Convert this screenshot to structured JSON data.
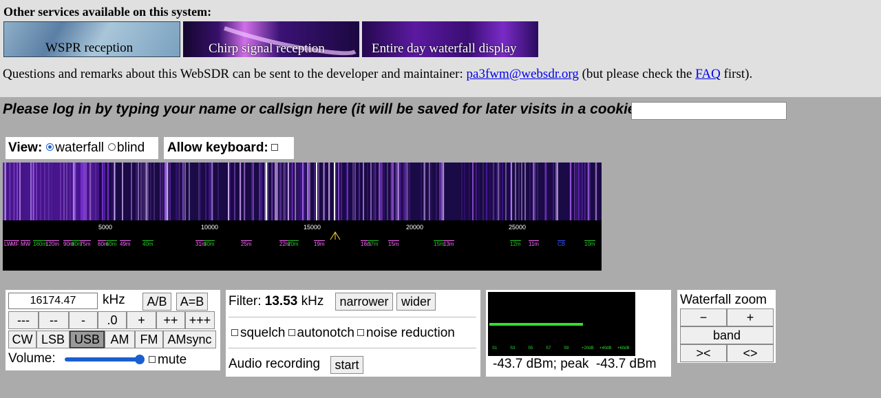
{
  "services": {
    "title": "Other services available on this system:",
    "items": [
      {
        "label": "WSPR reception"
      },
      {
        "label": "Chirp signal reception"
      },
      {
        "label": "Entire day waterfall display"
      }
    ]
  },
  "remarks": {
    "prefix": "Questions and remarks about this WebSDR can be sent to the developer and maintainer: ",
    "email": "pa3fwm@websdr.org",
    "middle": " (but please check the ",
    "faq": "FAQ",
    "suffix": " first)."
  },
  "login": {
    "prompt": "Please log in by typing your name or callsign here (it will be saved for later visits in a cookie):",
    "value": ""
  },
  "view": {
    "label": "View:",
    "options": [
      {
        "label": "waterfall",
        "selected": true
      },
      {
        "label": "blind",
        "selected": false
      }
    ]
  },
  "keyboard": {
    "label": "Allow keyboard:",
    "checked": false
  },
  "waterfall": {
    "ticks": [
      "5000",
      "10000",
      "15000",
      "20000",
      "25000"
    ],
    "bands": [
      {
        "label": "LW",
        "color": "#ff66ff"
      },
      {
        "label": "MF",
        "color": "#ff66ff"
      },
      {
        "label": "MW",
        "color": "#ff66ff"
      },
      {
        "label": "160m",
        "color": "#22cc22"
      },
      {
        "label": "120m",
        "color": "#ff66ff"
      },
      {
        "label": "90m",
        "color": "#ff66ff"
      },
      {
        "label": "80m",
        "color": "#22cc22"
      },
      {
        "label": "75m",
        "color": "#ff66ff"
      },
      {
        "label": "60m",
        "color": "#ff66ff"
      },
      {
        "label": "60m",
        "color": "#22cc22"
      },
      {
        "label": "49m",
        "color": "#ff66ff"
      },
      {
        "label": "40m",
        "color": "#22cc22"
      },
      {
        "label": "31m",
        "color": "#ff66ff"
      },
      {
        "label": "30m",
        "color": "#22cc22"
      },
      {
        "label": "25m",
        "color": "#ff66ff"
      },
      {
        "label": "22m",
        "color": "#ff66ff"
      },
      {
        "label": "20m",
        "color": "#22cc22"
      },
      {
        "label": "19m",
        "color": "#ff66ff"
      },
      {
        "label": "16m",
        "color": "#ff66ff"
      },
      {
        "label": "17m",
        "color": "#22cc22"
      },
      {
        "label": "15m",
        "color": "#ff66ff"
      },
      {
        "label": "15m",
        "color": "#22cc22"
      },
      {
        "label": "13m",
        "color": "#ff66ff"
      },
      {
        "label": "12m",
        "color": "#22cc22"
      },
      {
        "label": "11m",
        "color": "#ff66ff"
      },
      {
        "label": "CB",
        "color": "#3355ff"
      },
      {
        "label": "10m",
        "color": "#22cc22"
      }
    ]
  },
  "tuning": {
    "frequency": "16174.47",
    "unit": "kHz",
    "ab": "A/B",
    "aeqb": "A=B",
    "steps": [
      "---",
      "--",
      "-",
      ".0",
      "+",
      "++",
      "+++"
    ],
    "modes": [
      {
        "label": "CW",
        "active": false
      },
      {
        "label": "LSB",
        "active": false
      },
      {
        "label": "USB",
        "active": true
      },
      {
        "label": "AM",
        "active": false
      },
      {
        "label": "FM",
        "active": false
      },
      {
        "label": "AMsync",
        "active": false
      }
    ],
    "volume_label": "Volume:",
    "volume_level": 0.95,
    "mute_label": "mute"
  },
  "filter": {
    "label": "Filter: ",
    "value": "13.53",
    "unit": " kHz",
    "narrower": "narrower",
    "wider": "wider",
    "options": [
      "squelch",
      "autonotch",
      "noise reduction"
    ],
    "recording_label": "Audio recording",
    "start": "start"
  },
  "meter": {
    "scale": [
      "S1",
      "S3",
      "S5",
      "S7",
      "S9",
      "+20dB",
      "+40dB",
      "+60dB"
    ],
    "level": 0.64,
    "readout": "-43.7 dBm; peak  -43.7 dBm"
  },
  "zoom": {
    "title": "Waterfall zoom",
    "minus": "−",
    "plus": "+",
    "band": "band",
    "narrow": "><",
    "wide": "<>"
  }
}
